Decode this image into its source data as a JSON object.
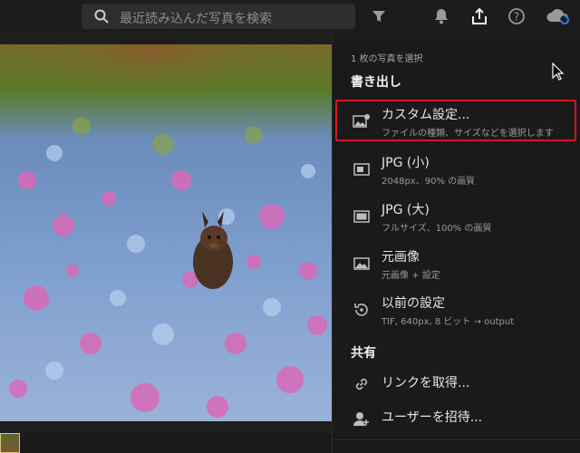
{
  "search": {
    "placeholder": "最近読み込んだ写真を検索"
  },
  "toolbar": {
    "filter_icon": "filter-icon",
    "bell_icon": "bell-icon",
    "share_icon": "share-icon",
    "help_icon": "help-icon",
    "cloud_icon": "cloud-sync-icon"
  },
  "share_panel": {
    "selection_count": "1 枚の写真を選択",
    "export_header": "書き出し",
    "items": [
      {
        "title": "カスタム設定...",
        "subtitle": "ファイルの種類、サイズなどを選択します",
        "icon": "custom-export-icon"
      },
      {
        "title": "JPG (小)",
        "subtitle": "2048px、90% の画質",
        "icon": "jpg-small-icon"
      },
      {
        "title": "JPG (大)",
        "subtitle": "フルサイズ、100% の画質",
        "icon": "jpg-large-icon"
      },
      {
        "title": "元画像",
        "subtitle": "元画像 + 設定",
        "icon": "original-image-icon"
      },
      {
        "title": "以前の設定",
        "subtitle": "TIF, 640px, 8 ビット → output",
        "icon": "previous-settings-icon"
      }
    ],
    "share_header": "共有",
    "share_items": [
      {
        "title": "リンクを取得...",
        "icon": "link-icon"
      },
      {
        "title": "ユーザーを招待...",
        "icon": "invite-user-icon"
      }
    ]
  },
  "colors": {
    "highlight": "#e01414",
    "panel_bg": "#1a1a1a",
    "accent_blue": "#2d7bf0"
  }
}
